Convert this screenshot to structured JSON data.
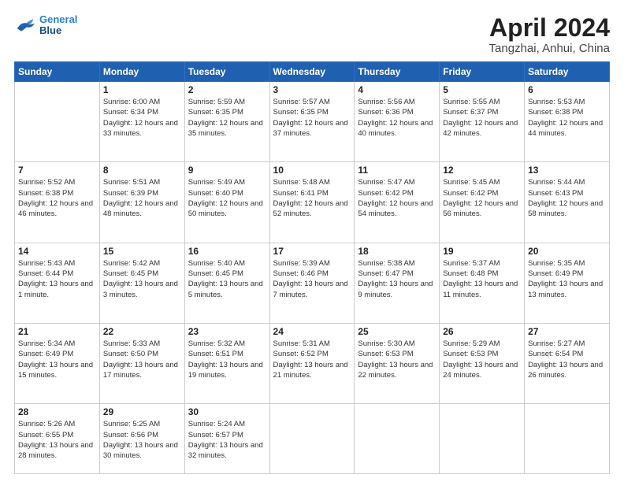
{
  "header": {
    "logo_line1": "General",
    "logo_line2": "Blue",
    "title": "April 2024",
    "subtitle": "Tangzhai, Anhui, China"
  },
  "weekdays": [
    "Sunday",
    "Monday",
    "Tuesday",
    "Wednesday",
    "Thursday",
    "Friday",
    "Saturday"
  ],
  "weeks": [
    [
      {
        "day": "",
        "empty": true
      },
      {
        "day": "1",
        "sunrise": "6:00 AM",
        "sunset": "6:34 PM",
        "daylight": "12 hours and 33 minutes."
      },
      {
        "day": "2",
        "sunrise": "5:59 AM",
        "sunset": "6:35 PM",
        "daylight": "12 hours and 35 minutes."
      },
      {
        "day": "3",
        "sunrise": "5:57 AM",
        "sunset": "6:35 PM",
        "daylight": "12 hours and 37 minutes."
      },
      {
        "day": "4",
        "sunrise": "5:56 AM",
        "sunset": "6:36 PM",
        "daylight": "12 hours and 40 minutes."
      },
      {
        "day": "5",
        "sunrise": "5:55 AM",
        "sunset": "6:37 PM",
        "daylight": "12 hours and 42 minutes."
      },
      {
        "day": "6",
        "sunrise": "5:53 AM",
        "sunset": "6:38 PM",
        "daylight": "12 hours and 44 minutes."
      }
    ],
    [
      {
        "day": "7",
        "sunrise": "5:52 AM",
        "sunset": "6:38 PM",
        "daylight": "12 hours and 46 minutes."
      },
      {
        "day": "8",
        "sunrise": "5:51 AM",
        "sunset": "6:39 PM",
        "daylight": "12 hours and 48 minutes."
      },
      {
        "day": "9",
        "sunrise": "5:49 AM",
        "sunset": "6:40 PM",
        "daylight": "12 hours and 50 minutes."
      },
      {
        "day": "10",
        "sunrise": "5:48 AM",
        "sunset": "6:41 PM",
        "daylight": "12 hours and 52 minutes."
      },
      {
        "day": "11",
        "sunrise": "5:47 AM",
        "sunset": "6:42 PM",
        "daylight": "12 hours and 54 minutes."
      },
      {
        "day": "12",
        "sunrise": "5:45 AM",
        "sunset": "6:42 PM",
        "daylight": "12 hours and 56 minutes."
      },
      {
        "day": "13",
        "sunrise": "5:44 AM",
        "sunset": "6:43 PM",
        "daylight": "12 hours and 58 minutes."
      }
    ],
    [
      {
        "day": "14",
        "sunrise": "5:43 AM",
        "sunset": "6:44 PM",
        "daylight": "13 hours and 1 minute."
      },
      {
        "day": "15",
        "sunrise": "5:42 AM",
        "sunset": "6:45 PM",
        "daylight": "13 hours and 3 minutes."
      },
      {
        "day": "16",
        "sunrise": "5:40 AM",
        "sunset": "6:45 PM",
        "daylight": "13 hours and 5 minutes."
      },
      {
        "day": "17",
        "sunrise": "5:39 AM",
        "sunset": "6:46 PM",
        "daylight": "13 hours and 7 minutes."
      },
      {
        "day": "18",
        "sunrise": "5:38 AM",
        "sunset": "6:47 PM",
        "daylight": "13 hours and 9 minutes."
      },
      {
        "day": "19",
        "sunrise": "5:37 AM",
        "sunset": "6:48 PM",
        "daylight": "13 hours and 11 minutes."
      },
      {
        "day": "20",
        "sunrise": "5:35 AM",
        "sunset": "6:49 PM",
        "daylight": "13 hours and 13 minutes."
      }
    ],
    [
      {
        "day": "21",
        "sunrise": "5:34 AM",
        "sunset": "6:49 PM",
        "daylight": "13 hours and 15 minutes."
      },
      {
        "day": "22",
        "sunrise": "5:33 AM",
        "sunset": "6:50 PM",
        "daylight": "13 hours and 17 minutes."
      },
      {
        "day": "23",
        "sunrise": "5:32 AM",
        "sunset": "6:51 PM",
        "daylight": "13 hours and 19 minutes."
      },
      {
        "day": "24",
        "sunrise": "5:31 AM",
        "sunset": "6:52 PM",
        "daylight": "13 hours and 21 minutes."
      },
      {
        "day": "25",
        "sunrise": "5:30 AM",
        "sunset": "6:53 PM",
        "daylight": "13 hours and 22 minutes."
      },
      {
        "day": "26",
        "sunrise": "5:29 AM",
        "sunset": "6:53 PM",
        "daylight": "13 hours and 24 minutes."
      },
      {
        "day": "27",
        "sunrise": "5:27 AM",
        "sunset": "6:54 PM",
        "daylight": "13 hours and 26 minutes."
      }
    ],
    [
      {
        "day": "28",
        "sunrise": "5:26 AM",
        "sunset": "6:55 PM",
        "daylight": "13 hours and 28 minutes."
      },
      {
        "day": "29",
        "sunrise": "5:25 AM",
        "sunset": "6:56 PM",
        "daylight": "13 hours and 30 minutes."
      },
      {
        "day": "30",
        "sunrise": "5:24 AM",
        "sunset": "6:57 PM",
        "daylight": "13 hours and 32 minutes."
      },
      {
        "day": "",
        "empty": true
      },
      {
        "day": "",
        "empty": true
      },
      {
        "day": "",
        "empty": true
      },
      {
        "day": "",
        "empty": true
      }
    ]
  ],
  "labels": {
    "sunrise_prefix": "Sunrise: ",
    "sunset_prefix": "Sunset: ",
    "daylight_prefix": "Daylight: "
  }
}
